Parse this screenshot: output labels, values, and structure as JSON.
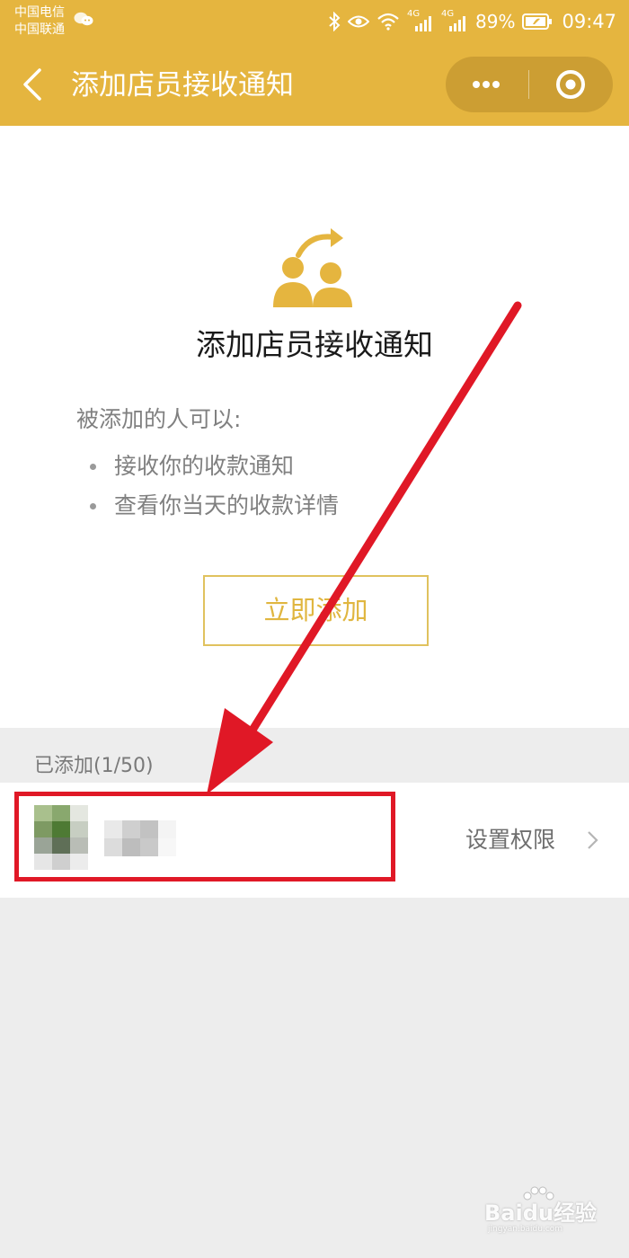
{
  "status_bar": {
    "carrier_1": "中国电信",
    "carrier_2": "中国联通",
    "network_1": "4G",
    "network_2": "4G",
    "battery": "89%",
    "time": "09:47"
  },
  "nav": {
    "title": "添加店员接收通知"
  },
  "card": {
    "title": "添加店员接收通知",
    "desc_head": "被添加的人可以:",
    "bullets": [
      "接收你的收款通知",
      "查看你当天的收款详情"
    ],
    "add_button": "立即添加"
  },
  "added": {
    "label": "已添加(1/50)",
    "member": {
      "permission_label": "设置权限"
    }
  },
  "watermark": {
    "brand": "Baidu经验",
    "url": "jingyan.baidu.com"
  },
  "colors": {
    "header": "#e5b53f",
    "accent": "#e0b640",
    "annotation": "#e01826",
    "background": "#ededed"
  }
}
